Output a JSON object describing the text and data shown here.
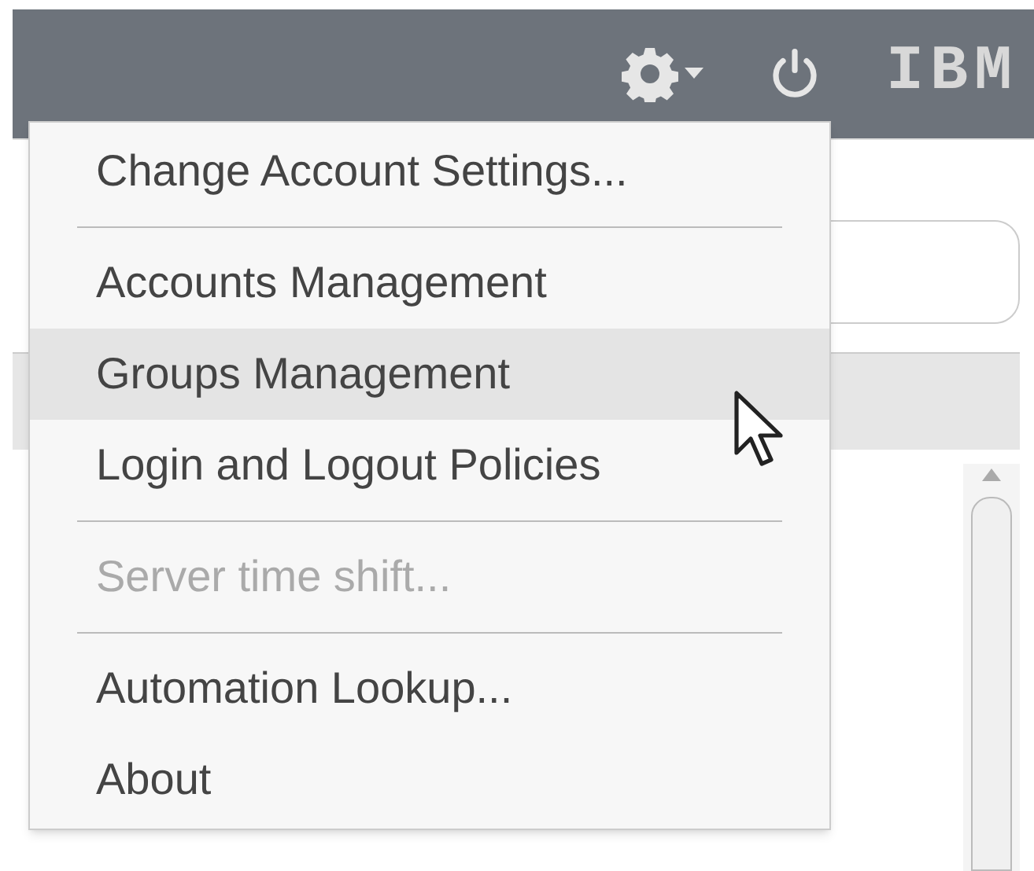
{
  "header": {
    "logo": "IBM"
  },
  "menu": {
    "sections": [
      [
        {
          "label": "Change Account Settings...",
          "selected": false,
          "disabled": false
        }
      ],
      [
        {
          "label": "Accounts Management",
          "selected": false,
          "disabled": false
        },
        {
          "label": "Groups Management",
          "selected": true,
          "disabled": false
        },
        {
          "label": "Login and Logout Policies",
          "selected": false,
          "disabled": false
        }
      ],
      [
        {
          "label": "Server time shift...",
          "selected": false,
          "disabled": true
        }
      ],
      [
        {
          "label": "Automation Lookup...",
          "selected": false,
          "disabled": false
        },
        {
          "label": "About",
          "selected": false,
          "disabled": false
        }
      ]
    ]
  }
}
